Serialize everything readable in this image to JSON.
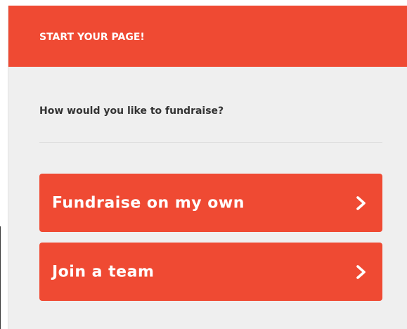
{
  "header": {
    "title": "START YOUR PAGE!"
  },
  "main": {
    "question": "How would you like to fundraise?",
    "options": [
      {
        "label": "Fundraise on my own",
        "icon": "chevron-right-icon"
      },
      {
        "label": "Join a team",
        "icon": "chevron-right-icon"
      }
    ]
  },
  "colors": {
    "accent": "#ef4a33",
    "panel_background": "#efefef",
    "text": "#333333",
    "divider": "#dddddd"
  }
}
